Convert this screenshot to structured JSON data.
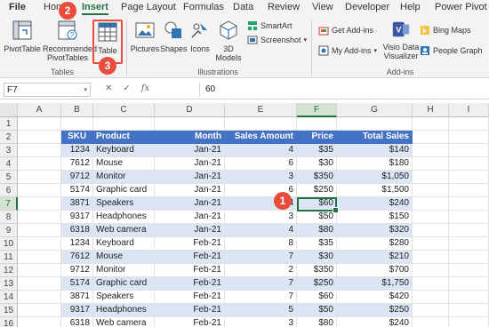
{
  "tabs": [
    "File",
    "Home",
    "Insert",
    "Page Layout",
    "Formulas",
    "Data",
    "Review",
    "View",
    "Developer",
    "Help",
    "Power Pivot"
  ],
  "ribbon": {
    "pivottable": "PivotTable",
    "recommended_l1": "Recommended",
    "recommended_l2": "PivotTables",
    "table": "Table",
    "tables_group": "Tables",
    "pictures": "Pictures",
    "shapes": "Shapes",
    "icons": "Icons",
    "models_l1": "3D",
    "models_l2": "Models",
    "smartart": "SmartArt",
    "screenshot": "Screenshot",
    "illustrations_group": "Illustrations",
    "get_addins": "Get Add-ins",
    "my_addins": "My Add-ins",
    "visio_l1": "Visio Data",
    "visio_l2": "Visualizer",
    "bing_maps": "Bing Maps",
    "people_graph": "People Graph",
    "addins_group": "Add-ins"
  },
  "formula_bar": {
    "name_box": "F7",
    "value": "60",
    "cancel": "✕",
    "enter": "✓",
    "fx": "fx"
  },
  "columns": [
    "A",
    "B",
    "C",
    "D",
    "E",
    "F",
    "G",
    "H",
    "I"
  ],
  "rows": [
    "1",
    "2",
    "3",
    "4",
    "5",
    "6",
    "7",
    "8",
    "9",
    "10",
    "11",
    "12",
    "13",
    "14",
    "15",
    "16"
  ],
  "table": {
    "headers": [
      "SKU",
      "Product",
      "Month",
      "Sales Amount",
      "Price",
      "Total Sales"
    ],
    "rows": [
      [
        "1234",
        "Keyboard",
        "Jan-21",
        "4",
        "$35",
        "$140"
      ],
      [
        "7612",
        "Mouse",
        "Jan-21",
        "6",
        "$30",
        "$180"
      ],
      [
        "9712",
        "Monitor",
        "Jan-21",
        "3",
        "$350",
        "$1,050"
      ],
      [
        "5174",
        "Graphic card",
        "Jan-21",
        "6",
        "$250",
        "$1,500"
      ],
      [
        "3871",
        "Speakers",
        "Jan-21",
        "4",
        "$60",
        "$240"
      ],
      [
        "9317",
        "Headphones",
        "Jan-21",
        "3",
        "$50",
        "$150"
      ],
      [
        "6318",
        "Web camera",
        "Jan-21",
        "4",
        "$80",
        "$320"
      ],
      [
        "1234",
        "Keyboard",
        "Feb-21",
        "8",
        "$35",
        "$280"
      ],
      [
        "7612",
        "Mouse",
        "Feb-21",
        "7",
        "$30",
        "$210"
      ],
      [
        "9712",
        "Monitor",
        "Feb-21",
        "2",
        "$350",
        "$700"
      ],
      [
        "5174",
        "Graphic card",
        "Feb-21",
        "7",
        "$250",
        "$1,750"
      ],
      [
        "3871",
        "Speakers",
        "Feb-21",
        "7",
        "$60",
        "$420"
      ],
      [
        "9317",
        "Headphones",
        "Feb-21",
        "5",
        "$50",
        "$250"
      ],
      [
        "6318",
        "Web camera",
        "Feb-21",
        "3",
        "$80",
        "$240"
      ]
    ]
  },
  "badges": [
    "1",
    "2",
    "3"
  ],
  "colors": {
    "accent": "#217346",
    "table_header": "#4472c4",
    "band": "#dbe5f3",
    "badge": "#e74c3c"
  }
}
